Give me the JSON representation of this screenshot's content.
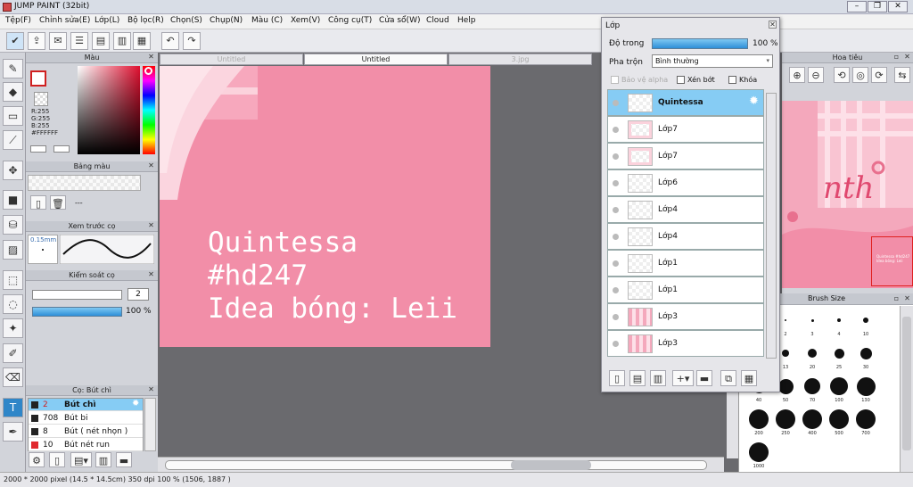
{
  "app": {
    "title": "JUMP PAINT (32bit)"
  },
  "menu": [
    "Tệp(F)",
    "Chỉnh sửa(E)",
    "Lớp(L)",
    "Bộ lọc(R)",
    "Chọn(S)",
    "Chụp(N)",
    "Màu (C)",
    "Xem(V)",
    "Công cụ(T)",
    "Cửa sổ(W)",
    "Cloud",
    "Help"
  ],
  "panels": {
    "color": {
      "title": "Màu",
      "r": "R:255",
      "g": "G:255",
      "b": "B:255",
      "hex": "#FFFFFF"
    },
    "palette": {
      "title": "Bảng màu",
      "dashes": "---"
    },
    "preview": {
      "title": "Xem trước cọ",
      "size": "0.15mm"
    },
    "control": {
      "title": "Kiểm soát cọ",
      "size_value": "2",
      "opacity": "100 %",
      "opacity_fill": 1.0
    },
    "brush": {
      "title": "Cọ: Bút chì",
      "items": [
        {
          "size": "2",
          "name": "Bút chì",
          "color": "#222222",
          "selected": true
        },
        {
          "size": "708",
          "name": "Bút bi",
          "color": "#222222",
          "selected": false
        },
        {
          "size": "8",
          "name": "Bút ( nét nhọn )",
          "color": "#222222",
          "selected": false
        },
        {
          "size": "10",
          "name": "Bút nét run",
          "color": "#e0282e",
          "selected": false
        }
      ]
    }
  },
  "tabs": [
    "Untitled",
    "Untitled",
    "3.jpg"
  ],
  "canvas": {
    "lines": [
      "Quintessa",
      "#hd247",
      "Idea bóng: Leii"
    ],
    "color": "#f28ea8"
  },
  "layers": {
    "title": "Lớp",
    "opacity_label": "Độ trong",
    "opacity_value": "100 %",
    "opacity_fill": 1.0,
    "blend_label": "Pha trộn",
    "blend_value": "Bình thường",
    "protect_alpha": "Bảo vệ alpha",
    "clip": "Xén bớt",
    "lock": "Khóa",
    "list": [
      {
        "name": "Quintessa",
        "selected": true
      },
      {
        "name": "Lớp7",
        "selected": false
      },
      {
        "name": "Lớp7",
        "selected": false
      },
      {
        "name": "Lớp6",
        "selected": false
      },
      {
        "name": "Lớp4",
        "selected": false
      },
      {
        "name": "Lớp4",
        "selected": false
      },
      {
        "name": "Lớp1",
        "selected": false
      },
      {
        "name": "Lớp1",
        "selected": false
      },
      {
        "name": "Lớp3",
        "selected": false
      },
      {
        "name": "Lớp3",
        "selected": false
      }
    ]
  },
  "navigator": {
    "title": "Hoa tiêu",
    "art_text": "nth",
    "tiny_text": "Quintessa #hd247 Idea bóng: Leii"
  },
  "brushsize": {
    "title": "Brush Size",
    "sizes": [
      "1",
      "2",
      "3",
      "4",
      "10",
      "12",
      "13",
      "20",
      "25",
      "30",
      "40",
      "50",
      "70",
      "100",
      "130",
      "200",
      "250",
      "400",
      "500",
      "700",
      "1000"
    ]
  },
  "status": "2000 * 2000 pixel  (14.5 * 14.5cm)  350 dpi  100 %  (1506, 1887 )"
}
